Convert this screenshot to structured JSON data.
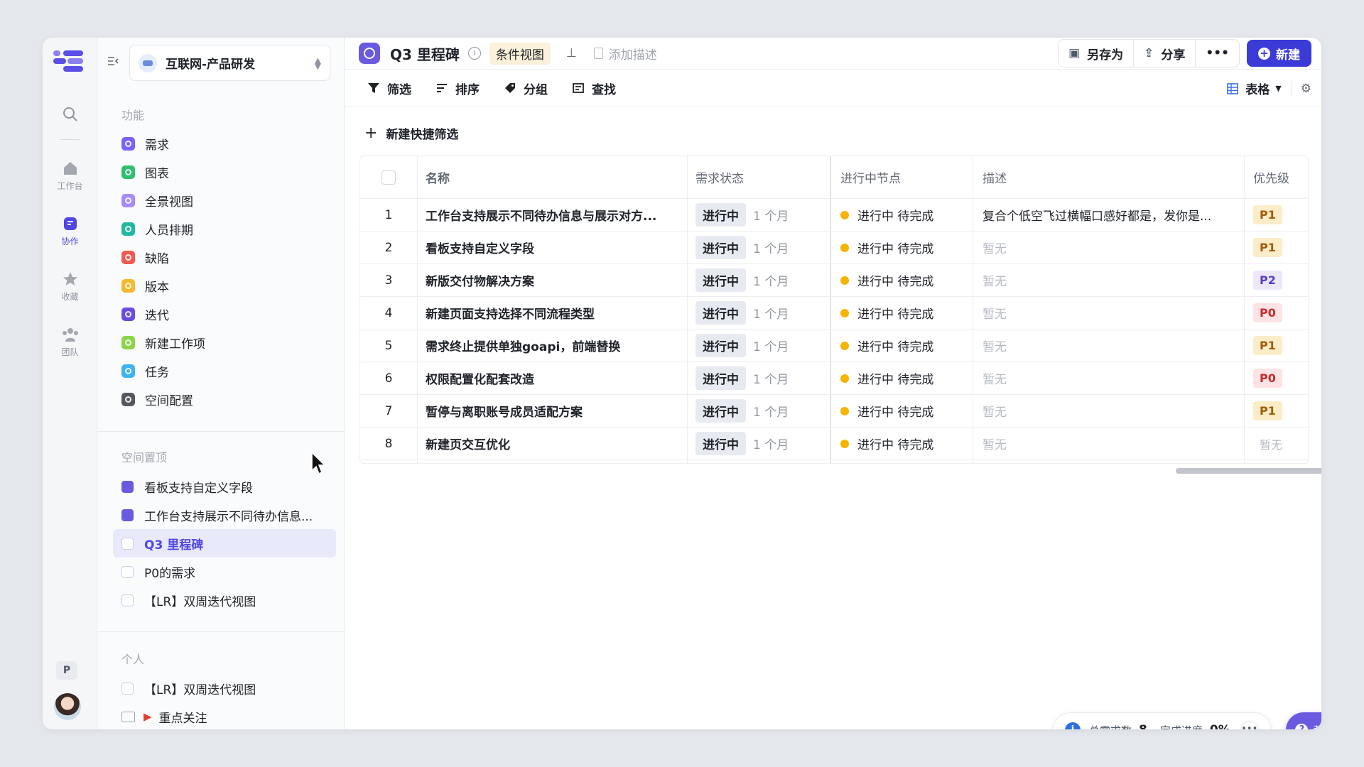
{
  "rail": {
    "items": [
      {
        "icon": "search-icon",
        "label": ""
      },
      {
        "icon": "home-icon",
        "label": "工作台"
      },
      {
        "icon": "collab-icon",
        "label": "协作"
      },
      {
        "icon": "star-icon",
        "label": "收藏"
      },
      {
        "icon": "team-icon",
        "label": "团队"
      }
    ],
    "user_badge": "P"
  },
  "sidebar": {
    "workspace": "互联网-产品研发",
    "section_features": "功能",
    "features": [
      {
        "label": "需求",
        "color": "#7b61ff"
      },
      {
        "label": "图表",
        "color": "#2fbf71"
      },
      {
        "label": "全景视图",
        "color": "#a78bfa"
      },
      {
        "label": "人员排期",
        "color": "#22b8a0"
      },
      {
        "label": "缺陷",
        "color": "#f05a4f"
      },
      {
        "label": "版本",
        "color": "#f5b92e"
      },
      {
        "label": "迭代",
        "color": "#6a4ce0"
      },
      {
        "label": "新建工作项",
        "color": "#8cd44a"
      },
      {
        "label": "任务",
        "color": "#3fb3f0"
      },
      {
        "label": "空间配置",
        "color": "#55595f"
      }
    ],
    "section_pinned": "空间置顶",
    "pinned": [
      {
        "label": "看板支持自定义字段",
        "style": "filled"
      },
      {
        "label": "工作台支持展示不同待办信息...",
        "style": "filled"
      },
      {
        "label": "Q3 里程碑",
        "style": "light",
        "active": true
      },
      {
        "label": "P0的需求",
        "style": "light"
      },
      {
        "label": "【LR】双周迭代视图",
        "style": "light"
      }
    ],
    "section_personal": "个人",
    "personal": [
      {
        "label": "【LR】双周迭代视图"
      },
      {
        "label": "重点关注"
      }
    ]
  },
  "header": {
    "title": "Q3 里程碑",
    "view_tag": "条件视图",
    "add_desc": "添加描述",
    "save_as": "另存为",
    "share": "分享",
    "new": "新建"
  },
  "toolbar": {
    "filter": "筛选",
    "sort": "排序",
    "group": "分组",
    "find": "查找",
    "view_mode": "表格",
    "quick_filter": "新建快捷筛选"
  },
  "table": {
    "columns": [
      "名称",
      "需求状态",
      "进行中节点",
      "描述",
      "优先级"
    ],
    "rows": [
      {
        "no": "1",
        "name": "工作台支持展示不同待办信息与展示对方...",
        "status": "进行中",
        "dur": "1 个月",
        "node": "进行中 待完成",
        "desc": "复合个低空飞过横幅口感好都是，发你是...",
        "pri": "P1"
      },
      {
        "no": "2",
        "name": "看板支持自定义字段",
        "status": "进行中",
        "dur": "1 个月",
        "node": "进行中 待完成",
        "desc": "暂无",
        "pri": "P1"
      },
      {
        "no": "3",
        "name": "新版交付物解决方案",
        "status": "进行中",
        "dur": "1 个月",
        "node": "进行中 待完成",
        "desc": "暂无",
        "pri": "P2"
      },
      {
        "no": "4",
        "name": "新建页面支持选择不同流程类型",
        "status": "进行中",
        "dur": "1 个月",
        "node": "进行中 待完成",
        "desc": "暂无",
        "pri": "P0"
      },
      {
        "no": "5",
        "name": "需求终止提供单独goapi，前端替换",
        "status": "进行中",
        "dur": "1 个月",
        "node": "进行中 待完成",
        "desc": "暂无",
        "pri": "P1"
      },
      {
        "no": "6",
        "name": "权限配置化配套改造",
        "status": "进行中",
        "dur": "1 个月",
        "node": "进行中 待完成",
        "desc": "暂无",
        "pri": "P0"
      },
      {
        "no": "7",
        "name": "暂停与离职账号成员适配方案",
        "status": "进行中",
        "dur": "1 个月",
        "node": "进行中 待完成",
        "desc": "暂无",
        "pri": "P1"
      },
      {
        "no": "8",
        "name": "新建页交互优化",
        "status": "进行中",
        "dur": "1 个月",
        "node": "进行中 待完成",
        "desc": "暂无",
        "pri": "暂无"
      }
    ]
  },
  "footer": {
    "total_label": "总需求数",
    "total_value": "8",
    "progress_label": "完成进度",
    "progress_value": "0%",
    "help": "帮助"
  }
}
